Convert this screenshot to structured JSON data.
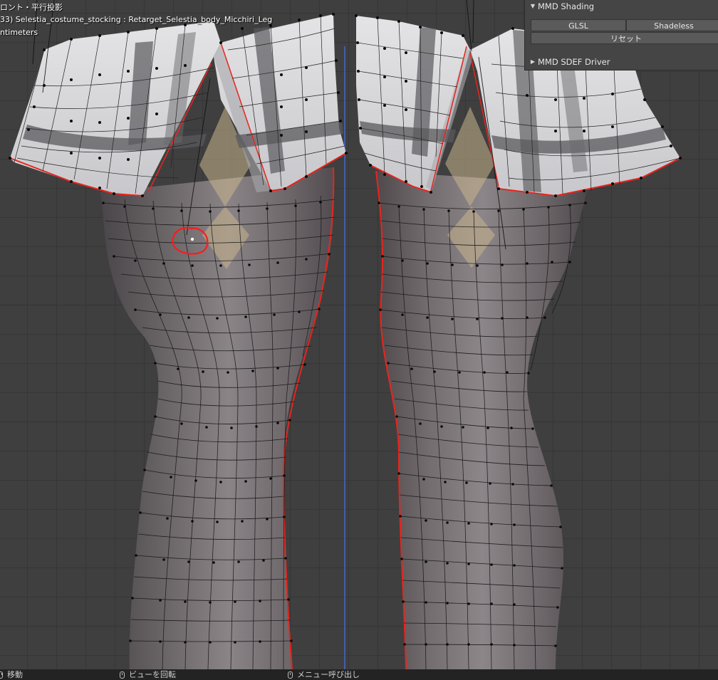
{
  "viewport": {
    "view_title": "ロント・平行投影",
    "object_info": "33) Selestia_costume_stocking : Retarget_Selestia_body_Micchiri_Leg",
    "units": "ntimeters"
  },
  "panel": {
    "mmd_shading": {
      "title": "MMD Shading",
      "glsl_label": "GLSL",
      "shadeless_label": "Shadeless",
      "reset_label": "リセット"
    },
    "sdef_driver": {
      "title": "MMD SDEF Driver"
    }
  },
  "statusbar": {
    "move_label": "移動",
    "rotate_view_label": "ビューを回転",
    "menu_label": "メニュー呼び出し"
  },
  "colors": {
    "seam": "#e8251d",
    "axis_line": "#4668c8",
    "annotation_circle": "#ff1a1a"
  }
}
